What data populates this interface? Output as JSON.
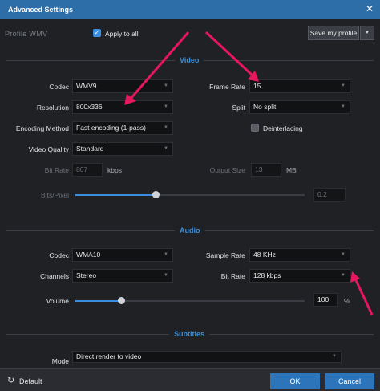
{
  "window": {
    "title": "Advanced Settings",
    "close_icon": "close-icon"
  },
  "profile": {
    "label": "Profile  WMV",
    "apply_to_all_label": "Apply to all",
    "apply_to_all_checked": true,
    "save_label": "Save my profile"
  },
  "video": {
    "section_title": "Video",
    "codec": {
      "label": "Codec",
      "value": "WMV9"
    },
    "resolution": {
      "label": "Resolution",
      "value": "800x336"
    },
    "encoding": {
      "label": "Encoding Method",
      "value": "Fast encoding (1-pass)"
    },
    "quality": {
      "label": "Video Quality",
      "value": "Standard"
    },
    "bitrate": {
      "label": "Bit Rate",
      "value": "807",
      "unit": "kbps"
    },
    "bits_pixel": {
      "label": "Bits/Pixel",
      "value": "0.2",
      "slider_fraction": 0.35
    },
    "frame_rate": {
      "label": "Frame Rate",
      "value": "15"
    },
    "split": {
      "label": "Split",
      "value": "No split"
    },
    "deinterlacing": {
      "label": "Deinterlacing",
      "checked": false
    },
    "output_size": {
      "label": "Output Size",
      "value": "13",
      "unit": "MB"
    }
  },
  "audio": {
    "section_title": "Audio",
    "codec": {
      "label": "Codec",
      "value": "WMA10"
    },
    "channels": {
      "label": "Channels",
      "value": "Stereo"
    },
    "volume": {
      "label": "Volume",
      "value": "100",
      "unit": "%",
      "slider_fraction": 0.2
    },
    "sample_rate": {
      "label": "Sample Rate",
      "value": "48 KHz"
    },
    "bit_rate": {
      "label": "Bit Rate",
      "value": "128 kbps"
    }
  },
  "subtitles": {
    "section_title": "Subtitles",
    "mode": {
      "label": "Mode",
      "value": "Direct render to video"
    }
  },
  "footer": {
    "default_label": "Default",
    "ok_label": "OK",
    "cancel_label": "Cancel"
  },
  "colors": {
    "accent": "#2d75bb",
    "section_title": "#3b8ed8",
    "annotation_arrow": "#e8175d"
  }
}
